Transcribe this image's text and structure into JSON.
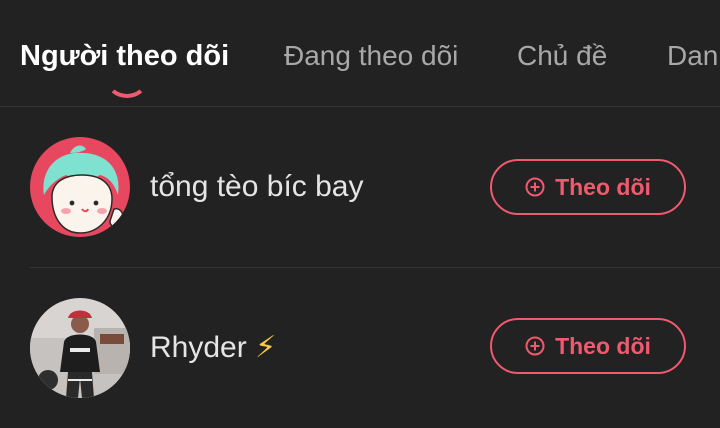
{
  "tabs": [
    {
      "label": "Người theo dõi",
      "active": true
    },
    {
      "label": "Đang theo dõi",
      "active": false
    },
    {
      "label": "Chủ đề",
      "active": false
    },
    {
      "label": "Danh",
      "active": false
    }
  ],
  "followers": [
    {
      "name": "tổng tèo bíc bay",
      "badge": "",
      "button_label": "Theo dõi",
      "button_icon": "plus-circle-icon"
    },
    {
      "name": "Rhyder",
      "badge": "⚡",
      "button_label": "Theo dõi",
      "button_icon": "plus-circle-icon"
    }
  ],
  "colors": {
    "background": "#232223",
    "accent": "#ef5a6f",
    "tab_active": "#ffffff",
    "tab_inactive": "#a9a8a9"
  }
}
